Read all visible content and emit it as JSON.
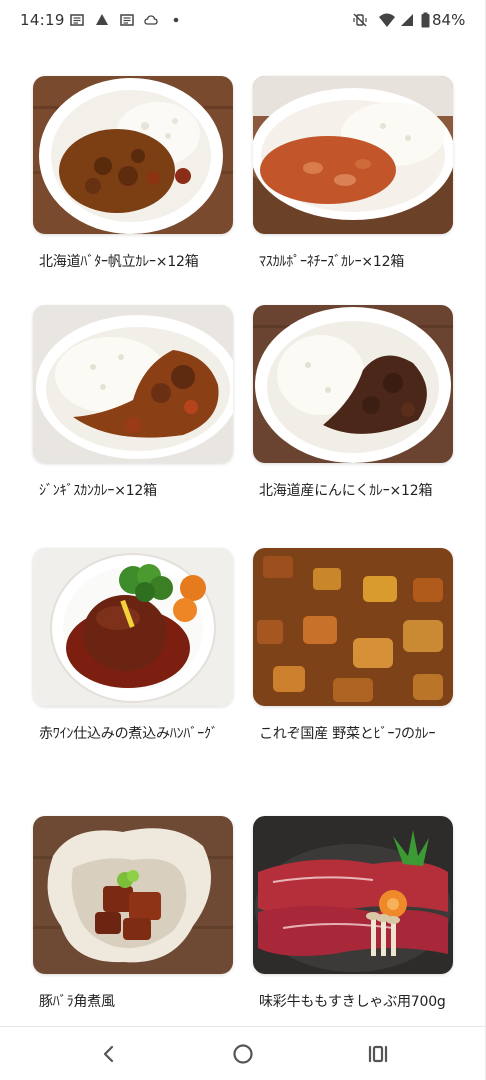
{
  "status_bar": {
    "time": "14:19",
    "battery": "84%"
  },
  "products": [
    {
      "title": "北海道ﾊﾞﾀｰ帆立ｶﾚｰ×12箱",
      "image": "curry-rice-plate"
    },
    {
      "title": "ﾏｽｶﾙﾎﾟｰﾈﾁｰｽﾞｶﾚｰ×12箱",
      "image": "curry-rice-plate"
    },
    {
      "title": "ｼﾞﾝｷﾞｽｶﾝｶﾚｰ×12箱",
      "image": "curry-rice-plate"
    },
    {
      "title": "北海道産にんにくｶﾚｰ×12箱",
      "image": "curry-rice-plate"
    },
    {
      "title": "赤ﾜｲﾝ仕込みの煮込みﾊﾝﾊﾞｰｸﾞ",
      "image": "hamburg-steak-plate"
    },
    {
      "title": "これぞ国産 野菜とﾋﾞｰﾌのｶﾚｰ",
      "image": "curry-closeup"
    },
    {
      "title": "豚ﾊﾞﾗ角煮風",
      "image": "braised-pork-bowl"
    },
    {
      "title": "味彩牛ももすきしゃぶ用700g",
      "image": "beef-sukiyaki-pan"
    }
  ],
  "colors": {
    "curry": "#8a4a1e",
    "rice": "#f7f4ec",
    "wood": "#6b4630",
    "beef": "#b8303a"
  }
}
